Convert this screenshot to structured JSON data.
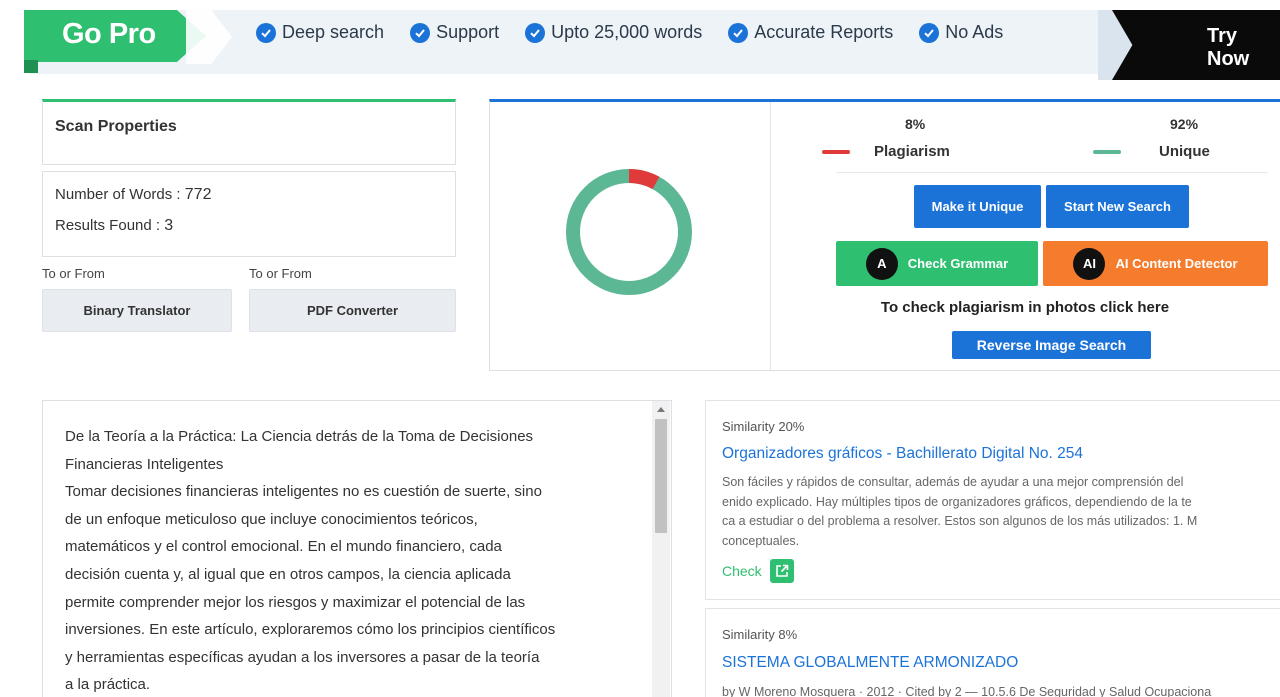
{
  "promo": {
    "go_pro": "Go Pro",
    "features": [
      "Deep search",
      "Support",
      "Upto 25,000 words",
      "Accurate Reports",
      "No Ads"
    ],
    "try_now": "Try Now"
  },
  "scan": {
    "title": "Scan Properties",
    "words_label": "Number of Words : ",
    "words_value": "772",
    "results_label": "Results Found : ",
    "results_value": "3",
    "tools": [
      {
        "caption": "To or From",
        "button": "Binary Translator"
      },
      {
        "caption": "To or From",
        "button": "PDF Converter"
      }
    ]
  },
  "result": {
    "plagiarism_pct": "8%",
    "plagiarism_label": "Plagiarism",
    "unique_pct": "92%",
    "unique_label": "Unique",
    "plagiarism_fraction": 0.08,
    "colors": {
      "plagiarism": "#e03a3a",
      "unique": "#5cb894"
    },
    "buttons": {
      "make_unique": "Make it Unique",
      "new_search": "Start New Search",
      "grammar": "Check Grammar",
      "grammar_icon": "A",
      "ai_detector": "AI Content Detector",
      "ai_icon": "AI",
      "reverse_image": "Reverse Image Search"
    },
    "photo_hint": "To check plagiarism in photos click here"
  },
  "editor": {
    "lines": [
      "De la Teoría a la Práctica: La Ciencia detrás de la Toma de Decisiones",
      "Financieras Inteligentes",
      "Tomar decisiones financieras inteligentes no es cuestión de suerte, sino",
      "de un enfoque meticuloso que incluye conocimientos teóricos,",
      "matemáticos y el control emocional. En el mundo financiero, cada",
      "decisión cuenta y, al igual que en otros campos, la ciencia aplicada",
      "permite comprender mejor los riesgos y maximizar el potencial de las",
      "inversiones. En este artículo, exploraremos cómo los principios científicos",
      "y herramientas específicas ayudan a los inversores a pasar de la teoría",
      "a la práctica."
    ]
  },
  "sources": [
    {
      "similarity": "Similarity 20%",
      "title": "Organizadores gráficos - Bachillerato Digital No. 254",
      "snippet_lines": [
        "Son fáciles y rápidos de consultar, además de ayudar a una mejor comprensión del",
        "enido explicado. Hay múltiples tipos de organizadores gráficos, dependiendo de la te",
        "ca a estudiar o del problema a resolver. Estos son algunos de los más utilizados: 1. M",
        "conceptuales."
      ],
      "check": "Check"
    },
    {
      "similarity": "Similarity 8%",
      "title": "SISTEMA GLOBALMENTE ARMONIZADO",
      "byline": "by W Moreno Mosquera · 2012 · Cited by 2 — 10.5.6 De Seguridad y Salud Ocupaciona"
    }
  ]
}
